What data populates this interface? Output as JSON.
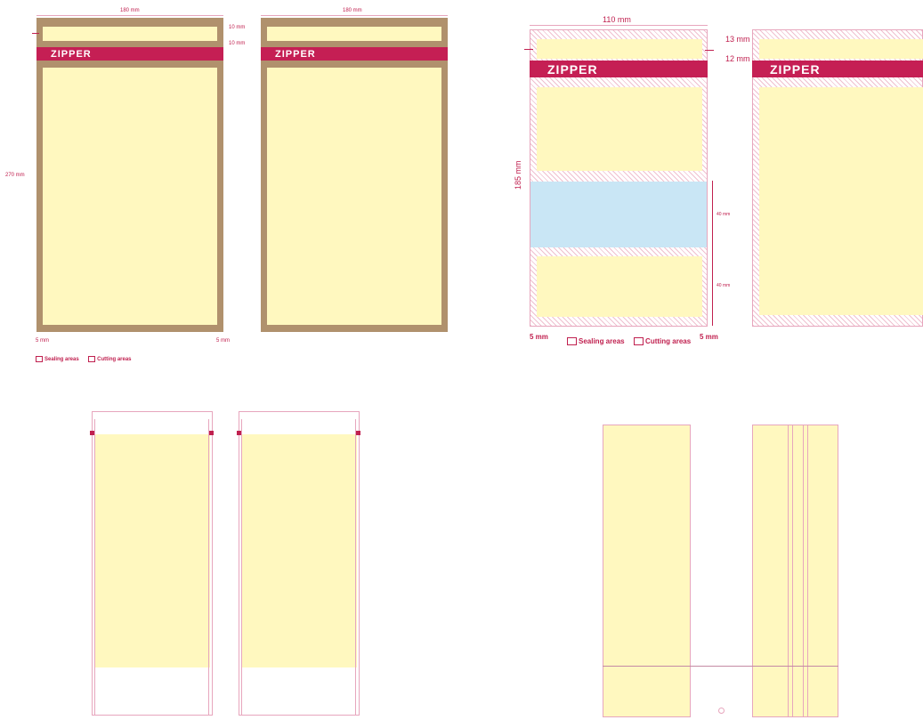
{
  "panel_a": {
    "width_label_left": "180 mm",
    "width_label_right": "180 mm",
    "top_margin_label": "10 mm",
    "zipper_gap_label": "10 mm",
    "height_label": "270 mm",
    "zipper_text": "ZIPPER",
    "bottom_left_label": "5 mm",
    "bottom_right_label": "5 mm",
    "legend": [
      "Sealing areas",
      "Cutting areas"
    ]
  },
  "panel_b": {
    "width_label": "110 mm",
    "top_label": "13 mm",
    "zipper_label": "12 mm",
    "height_label": "185 mm",
    "window_label_1": "40 mm",
    "window_label_2": "40 mm",
    "zipper_text": "ZIPPER",
    "bottom_left_label": "5 mm",
    "bottom_right_label": "5 mm",
    "legend": [
      "Sealing areas",
      "Cutting areas"
    ]
  },
  "colors": {
    "print_area": "#fff8bf",
    "kraft_seal": "#b0916d",
    "zipper": "#c51f54",
    "cut_line": "#e7a6bd",
    "window": "#c9e6f5"
  }
}
